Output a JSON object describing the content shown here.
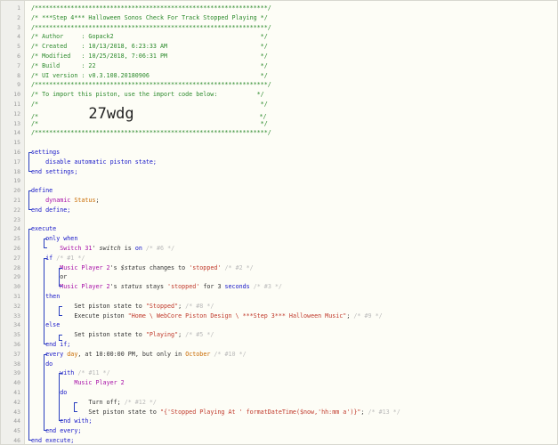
{
  "code_lines": [
    {
      "n": "1",
      "seg": [
        {
          "c": "cm",
          "t": "/*****************************************************************/"
        }
      ]
    },
    {
      "n": "2",
      "seg": [
        {
          "c": "cm",
          "t": "/* ***Step 4*** Halloween Sonos Check For Track Stopped Playing */"
        }
      ]
    },
    {
      "n": "3",
      "seg": [
        {
          "c": "cm",
          "t": "/*****************************************************************/"
        }
      ]
    },
    {
      "n": "4",
      "seg": [
        {
          "c": "cm",
          "t": "/* Author     : Gopack2                                         */"
        }
      ]
    },
    {
      "n": "5",
      "seg": [
        {
          "c": "cm",
          "t": "/* Created    : 10/13/2018, 6:23:33 AM                          */"
        }
      ]
    },
    {
      "n": "6",
      "seg": [
        {
          "c": "cm",
          "t": "/* Modified   : 10/25/2018, 7:06:31 PM                          */"
        }
      ]
    },
    {
      "n": "7",
      "seg": [
        {
          "c": "cm",
          "t": "/* Build      : 22                                              */"
        }
      ]
    },
    {
      "n": "8",
      "seg": [
        {
          "c": "cm",
          "t": "/* UI version : v0.3.108.20180906                               */"
        }
      ]
    },
    {
      "n": "9",
      "seg": [
        {
          "c": "cm",
          "t": "/*****************************************************************/"
        }
      ]
    },
    {
      "n": "10",
      "seg": [
        {
          "c": "cm",
          "t": "/* To import this piston, use the import code below:           */"
        }
      ]
    },
    {
      "n": "11",
      "seg": [
        {
          "c": "cm",
          "t": "/*                                                              */"
        }
      ]
    },
    {
      "n": "12",
      "seg": [
        {
          "c": "cm",
          "t": "/*              "
        },
        {
          "c": "big",
          "t": "27wdg"
        },
        {
          "c": "cm",
          "t": "                                   */"
        }
      ]
    },
    {
      "n": "13",
      "seg": [
        {
          "c": "cm",
          "t": "/*                                                              */"
        }
      ]
    },
    {
      "n": "14",
      "seg": [
        {
          "c": "cm",
          "t": "/*****************************************************************/"
        }
      ]
    },
    {
      "n": "15",
      "seg": []
    },
    {
      "n": "16",
      "seg": [
        {
          "c": "kw",
          "t": "settings"
        }
      ]
    },
    {
      "n": "17",
      "seg": [
        {
          "c": "txt",
          "t": "    "
        },
        {
          "c": "kw",
          "t": "disable automatic piston state;"
        }
      ]
    },
    {
      "n": "18",
      "seg": [
        {
          "c": "kw",
          "t": "end settings;"
        }
      ]
    },
    {
      "n": "19",
      "seg": []
    },
    {
      "n": "20",
      "seg": [
        {
          "c": "kw",
          "t": "define"
        }
      ]
    },
    {
      "n": "21",
      "seg": [
        {
          "c": "txt",
          "t": "    "
        },
        {
          "c": "dev",
          "t": "dynamic"
        },
        {
          "c": "txt",
          "t": " "
        },
        {
          "c": "orange",
          "t": "Status"
        },
        {
          "c": "txt",
          "t": ";"
        }
      ]
    },
    {
      "n": "22",
      "seg": [
        {
          "c": "kw",
          "t": "end define;"
        }
      ]
    },
    {
      "n": "23",
      "seg": []
    },
    {
      "n": "24",
      "seg": [
        {
          "c": "kw",
          "t": "execute"
        }
      ]
    },
    {
      "n": "25",
      "seg": [
        {
          "c": "txt",
          "t": "    "
        },
        {
          "c": "kw",
          "t": "only when"
        }
      ]
    },
    {
      "n": "26",
      "seg": [
        {
          "c": "txt",
          "t": "        "
        },
        {
          "c": "dev",
          "t": "Switch 31"
        },
        {
          "c": "txt",
          "t": "' "
        },
        {
          "c": "var",
          "t": "switch"
        },
        {
          "c": "txt",
          "t": " is "
        },
        {
          "c": "kw",
          "t": "on"
        },
        {
          "c": "txt",
          "t": " "
        },
        {
          "c": "grey",
          "t": "/* #6 */"
        }
      ]
    },
    {
      "n": "27",
      "seg": [
        {
          "c": "txt",
          "t": "    "
        },
        {
          "c": "kw",
          "t": "if"
        },
        {
          "c": "txt",
          "t": " "
        },
        {
          "c": "grey",
          "t": "/* #1 */"
        }
      ]
    },
    {
      "n": "28",
      "seg": [
        {
          "c": "txt",
          "t": "        "
        },
        {
          "c": "dev",
          "t": "Music Player 2"
        },
        {
          "c": "txt",
          "t": "'s "
        },
        {
          "c": "var",
          "t": "$status"
        },
        {
          "c": "txt",
          "t": " changes to "
        },
        {
          "c": "str",
          "t": "'stopped'"
        },
        {
          "c": "txt",
          "t": " "
        },
        {
          "c": "grey",
          "t": "/* #2 */"
        }
      ]
    },
    {
      "n": "29",
      "seg": [
        {
          "c": "txt",
          "t": "        "
        },
        {
          "c": "txt",
          "t": "or"
        }
      ]
    },
    {
      "n": "30",
      "seg": [
        {
          "c": "txt",
          "t": "        "
        },
        {
          "c": "dev",
          "t": "Music Player 2"
        },
        {
          "c": "txt",
          "t": "'s "
        },
        {
          "c": "var",
          "t": "status"
        },
        {
          "c": "txt",
          "t": " stays "
        },
        {
          "c": "str",
          "t": "'stopped'"
        },
        {
          "c": "txt",
          "t": " for "
        },
        {
          "c": "txt",
          "t": "3"
        },
        {
          "c": "txt",
          "t": " "
        },
        {
          "c": "kw",
          "t": "seconds"
        },
        {
          "c": "txt",
          "t": " "
        },
        {
          "c": "grey",
          "t": "/* #3 */"
        }
      ]
    },
    {
      "n": "31",
      "seg": [
        {
          "c": "txt",
          "t": "    "
        },
        {
          "c": "kw",
          "t": "then"
        }
      ]
    },
    {
      "n": "32",
      "seg": [
        {
          "c": "txt",
          "t": "            "
        },
        {
          "c": "txt",
          "t": "Set piston state to "
        },
        {
          "c": "str",
          "t": "\"Stopped\""
        },
        {
          "c": "txt",
          "t": "; "
        },
        {
          "c": "grey",
          "t": "/* #8 */"
        }
      ]
    },
    {
      "n": "33",
      "seg": [
        {
          "c": "txt",
          "t": "            "
        },
        {
          "c": "txt",
          "t": "Execute piston "
        },
        {
          "c": "str",
          "t": "\"Home \\ WebCore Piston Design \\ ***Step 3*** Halloween Music\""
        },
        {
          "c": "txt",
          "t": "; "
        },
        {
          "c": "grey",
          "t": "/* #9 */"
        }
      ]
    },
    {
      "n": "34",
      "seg": [
        {
          "c": "txt",
          "t": "    "
        },
        {
          "c": "kw",
          "t": "else"
        }
      ]
    },
    {
      "n": "35",
      "seg": [
        {
          "c": "txt",
          "t": "            "
        },
        {
          "c": "txt",
          "t": "Set piston state to "
        },
        {
          "c": "str",
          "t": "\"Playing\""
        },
        {
          "c": "txt",
          "t": "; "
        },
        {
          "c": "grey",
          "t": "/* #5 */"
        }
      ]
    },
    {
      "n": "36",
      "seg": [
        {
          "c": "txt",
          "t": "    "
        },
        {
          "c": "kw",
          "t": "end if;"
        }
      ]
    },
    {
      "n": "37",
      "seg": [
        {
          "c": "txt",
          "t": "    "
        },
        {
          "c": "kw",
          "t": "every"
        },
        {
          "c": "txt",
          "t": " "
        },
        {
          "c": "orange",
          "t": "day"
        },
        {
          "c": "txt",
          "t": ", at "
        },
        {
          "c": "txt",
          "t": "10:00:00 PM"
        },
        {
          "c": "txt",
          "t": ", but only in "
        },
        {
          "c": "orange",
          "t": "October"
        },
        {
          "c": "txt",
          "t": " "
        },
        {
          "c": "grey",
          "t": "/* #10 */"
        }
      ]
    },
    {
      "n": "38",
      "seg": [
        {
          "c": "txt",
          "t": "    "
        },
        {
          "c": "kw",
          "t": "do"
        }
      ]
    },
    {
      "n": "39",
      "seg": [
        {
          "c": "txt",
          "t": "        "
        },
        {
          "c": "kw",
          "t": "with"
        },
        {
          "c": "txt",
          "t": " "
        },
        {
          "c": "grey",
          "t": "/* #11 */"
        }
      ]
    },
    {
      "n": "40",
      "seg": [
        {
          "c": "txt",
          "t": "            "
        },
        {
          "c": "dev",
          "t": "Music Player 2"
        }
      ]
    },
    {
      "n": "41",
      "seg": [
        {
          "c": "txt",
          "t": "        "
        },
        {
          "c": "kw",
          "t": "do"
        }
      ]
    },
    {
      "n": "42",
      "seg": [
        {
          "c": "txt",
          "t": "                "
        },
        {
          "c": "txt",
          "t": "Turn off; "
        },
        {
          "c": "grey",
          "t": "/* #12 */"
        }
      ]
    },
    {
      "n": "43",
      "seg": [
        {
          "c": "txt",
          "t": "                "
        },
        {
          "c": "txt",
          "t": "Set piston state to "
        },
        {
          "c": "str",
          "t": "\"{'Stopped Playing At ' formatDateTime($now,'hh:mm a')}\""
        },
        {
          "c": "txt",
          "t": "; "
        },
        {
          "c": "grey",
          "t": "/* #13 */"
        }
      ]
    },
    {
      "n": "44",
      "seg": [
        {
          "c": "txt",
          "t": "        "
        },
        {
          "c": "kw",
          "t": "end with;"
        }
      ]
    },
    {
      "n": "45",
      "seg": [
        {
          "c": "txt",
          "t": "    "
        },
        {
          "c": "kw",
          "t": "end every;"
        }
      ]
    },
    {
      "n": "46",
      "seg": [
        {
          "c": "kw",
          "t": "end execute;"
        }
      ]
    }
  ]
}
